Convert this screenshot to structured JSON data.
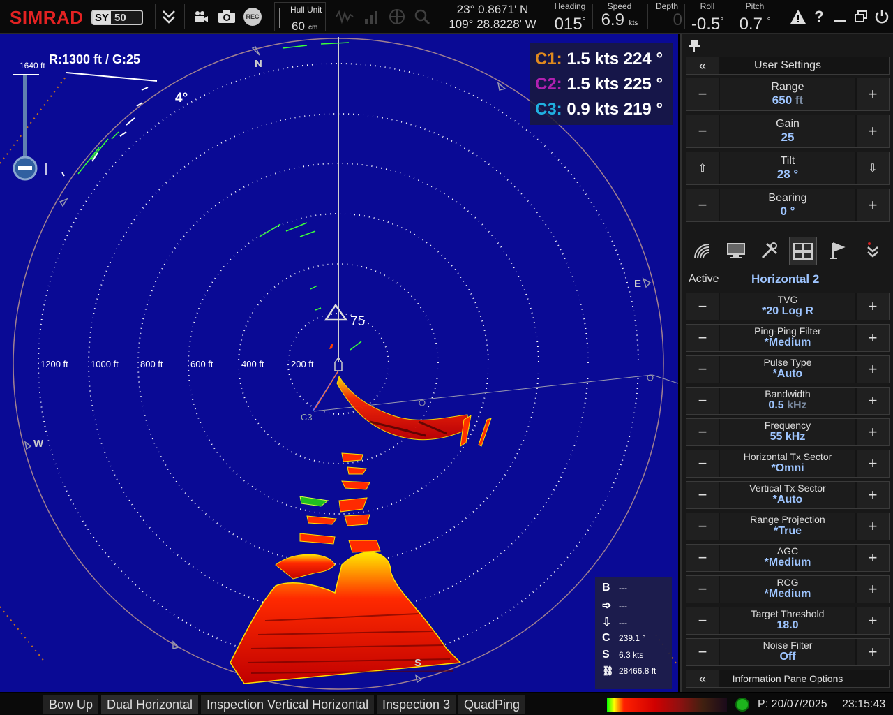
{
  "topbar": {
    "brand": "SIMRAD",
    "model_a": "SY",
    "model_b": "50",
    "hull_unit_label": "Hull Unit",
    "hull_unit_value": "60",
    "hull_unit_unit": "cm",
    "rec_label": "REC",
    "lat": "23° 0.8671' N",
    "lon": "109° 28.8228' W",
    "heading_label": "Heading",
    "heading_value": "015",
    "heading_unit": "°",
    "speed_label": "Speed",
    "speed_value": "6.9",
    "speed_unit": "kts",
    "depth_label": "Depth",
    "depth_value": "0",
    "roll_label": "Roll",
    "roll_value": "-0.5",
    "roll_unit": "°",
    "pitch_label": "Pitch",
    "pitch_value": "0.7",
    "pitch_unit": "°"
  },
  "sonar": {
    "range_gain_header": "R:1300 ft  / G:25",
    "scale_top": "1640 ft",
    "tilt_readout": "4°",
    "target_depth": "75",
    "range_rings": [
      "1200 ft",
      "1000 ft",
      "800 ft",
      "600 ft",
      "400 ft",
      "200 ft"
    ],
    "compass": {
      "n": "N",
      "e": "E",
      "s": "S",
      "w": "W"
    },
    "markers_text": "C3",
    "cursors": [
      {
        "id": "C1:",
        "value": "1.5 kts 224 °",
        "color": "#e08a1e"
      },
      {
        "id": "C2:",
        "value": "1.5 kts 225 °",
        "color": "#b020b0"
      },
      {
        "id": "C3:",
        "value": "0.9 kts 219 °",
        "color": "#20b0e0"
      }
    ],
    "info": [
      {
        "k": "B",
        "v": "---"
      },
      {
        "k": "➩",
        "v": "---"
      },
      {
        "k": "⇩",
        "v": "---"
      },
      {
        "k": "C",
        "v": "239.1 °"
      },
      {
        "k": "S",
        "v": "6.3 kts"
      },
      {
        "k": "⛓",
        "v": "28466.8 ft"
      }
    ]
  },
  "panel": {
    "user_settings": "User Settings",
    "range": {
      "label": "Range",
      "value": "650",
      "unit": "ft"
    },
    "gain": {
      "label": "Gain",
      "value": "25"
    },
    "tilt": {
      "label": "Tilt",
      "value": "28 °"
    },
    "bearing": {
      "label": "Bearing",
      "value": "0 °"
    },
    "active_label": "Active",
    "active_value": "Horizontal 2",
    "settings": [
      {
        "label": "TVG",
        "value": "*20 Log R"
      },
      {
        "label": "Ping-Ping Filter",
        "value": "*Medium"
      },
      {
        "label": "Pulse Type",
        "value": "*Auto"
      },
      {
        "label": "Bandwidth",
        "value": "0.5",
        "unit": "kHz"
      },
      {
        "label": "Frequency",
        "value": "55 kHz"
      },
      {
        "label": "Horizontal Tx Sector",
        "value": "*Omni"
      },
      {
        "label": "Vertical Tx Sector",
        "value": "*Auto"
      },
      {
        "label": "Range Projection",
        "value": "*True"
      },
      {
        "label": "AGC",
        "value": "*Medium"
      },
      {
        "label": "RCG",
        "value": "*Medium"
      },
      {
        "label": "Target Threshold",
        "value": "18.0"
      },
      {
        "label": "Noise Filter",
        "value": "Off"
      }
    ],
    "info_pane_options": "Information Pane Options"
  },
  "bottombar": {
    "tabs": [
      "Bow Up",
      "Dual Horizontal",
      "Inspection Vertical Horizontal",
      "Inspection 3",
      "QuadPing"
    ],
    "date": "P: 20/07/2025",
    "time": "23:15:43"
  }
}
